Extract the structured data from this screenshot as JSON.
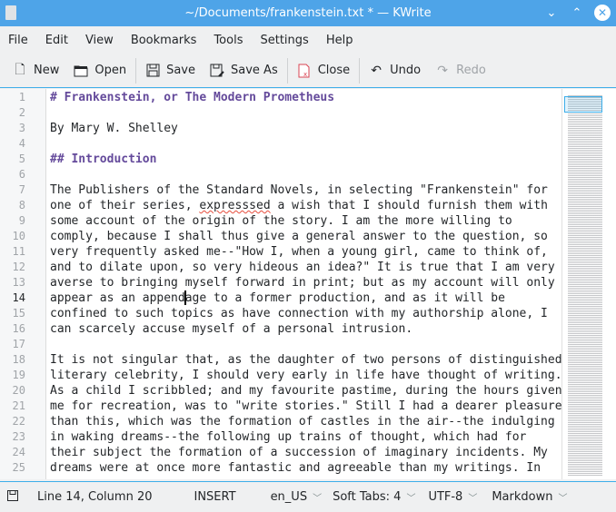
{
  "window": {
    "title": "~/Documents/frankenstein.txt * — KWrite"
  },
  "menu": [
    "File",
    "Edit",
    "View",
    "Bookmarks",
    "Tools",
    "Settings",
    "Help"
  ],
  "toolbar": {
    "new": "New",
    "open": "Open",
    "save": "Save",
    "save_as": "Save As",
    "close": "Close",
    "undo": "Undo",
    "redo": "Redo"
  },
  "editor": {
    "current_line": 14,
    "lines": [
      "# Frankenstein, or The Modern Prometheus",
      "",
      "By Mary W. Shelley",
      "",
      "## Introduction",
      "",
      "The Publishers of the Standard Novels, in selecting \"Frankenstein\" for",
      "one of their series, expresssed a wish that I should furnish them with",
      "some account of the origin of the story. I am the more willing to",
      "comply, because I shall thus give a general answer to the question, so",
      "very frequently asked me--\"How I, when a young girl, came to think of,",
      "and to dilate upon, so very hideous an idea?\" It is true that I am very",
      "averse to bringing myself forward in print; but as my account will only",
      "appear as an appendage to a former production, and as it will be",
      "confined to such topics as have connection with my authorship alone, I",
      "can scarcely accuse myself of a personal intrusion.",
      "",
      "It is not singular that, as the daughter of two persons of distinguished",
      "literary celebrity, I should very early in life have thought of writing.",
      "As a child I scribbled; and my favourite pastime, during the hours given",
      "me for recreation, was to \"write stories.\" Still I had a dearer pleasure",
      "than this, which was the formation of castles in the air--the indulging",
      "in waking dreams--the following up trains of thought, which had for",
      "their subject the formation of a succession of imaginary incidents. My",
      "dreams were at once more fantastic and agreeable than my writings. In"
    ],
    "misspelled_word": "expresssed"
  },
  "status": {
    "position": "Line 14, Column 20",
    "mode": "INSERT",
    "language": "en_US",
    "indent": "Soft Tabs: 4",
    "encoding": "UTF-8",
    "syntax": "Markdown"
  },
  "colors": {
    "accent": "#3daee9",
    "titlebar": "#4ea4e8",
    "heading": "#644a9b"
  }
}
